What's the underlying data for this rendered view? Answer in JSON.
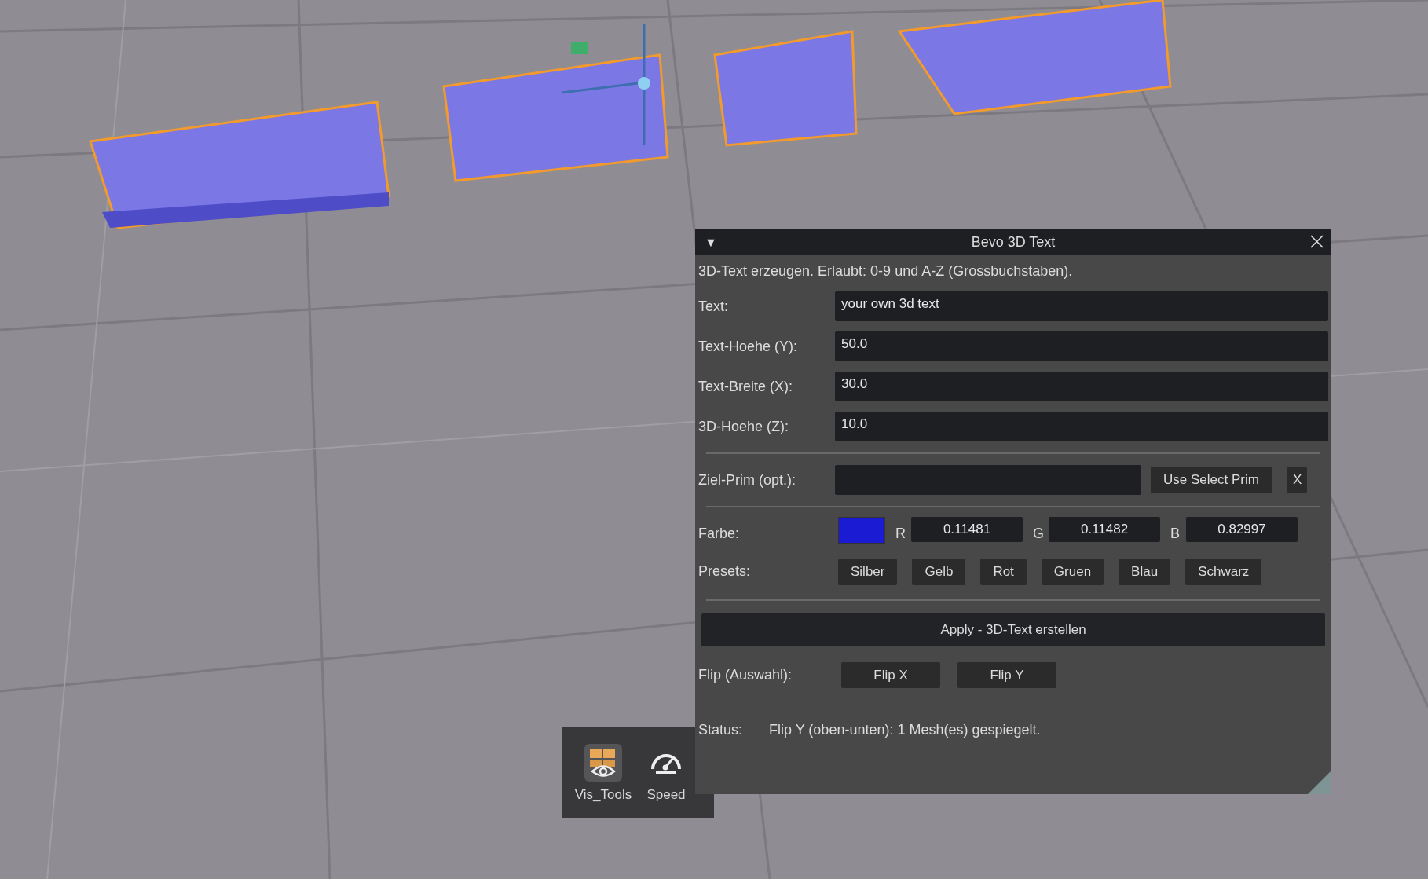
{
  "toolbar": {
    "items": [
      {
        "label": "Vis_Tools",
        "kind": "tiles",
        "selected": true
      },
      {
        "label": "Speed",
        "kind": "gauge",
        "selected": false
      }
    ]
  },
  "panel": {
    "title": "Bevo 3D Text",
    "collapse_glyph": "▼",
    "description": "3D-Text erzeugen. Erlaubt: 0-9 und A-Z (Grossbuchstaben).",
    "fields": [
      {
        "label": "Text:",
        "value": "your own 3d text"
      },
      {
        "label": "Text-Hoehe (Y):",
        "value": "50.0"
      },
      {
        "label": "Text-Breite (X):",
        "value": "30.0"
      },
      {
        "label": "3D-Hoehe (Z):",
        "value": "10.0"
      }
    ],
    "target": {
      "label": "Ziel-Prim (opt.):",
      "button": "Use Select Prim",
      "clear_button": "X"
    },
    "color": {
      "label": "Farbe:",
      "color": "#1c1bd4",
      "channels": [
        {
          "name": "R",
          "value": "0.11481"
        },
        {
          "name": "G",
          "value": "0.11482"
        },
        {
          "name": "B",
          "value": "0.82997"
        }
      ]
    },
    "presets": {
      "label": "Presets:",
      "buttons": [
        "Silber",
        "Gelb",
        "Rot",
        "Gruen",
        "Blau",
        "Schwarz"
      ]
    },
    "apply_button": "Apply - 3D-Text erstellen",
    "flip": {
      "label": "Flip (Auswahl):",
      "buttons": [
        "Flip X",
        "Flip Y"
      ]
    },
    "status": {
      "label": "Status:",
      "text": "Flip Y (oben-unten): 1 Mesh(es) gespiegelt."
    }
  }
}
